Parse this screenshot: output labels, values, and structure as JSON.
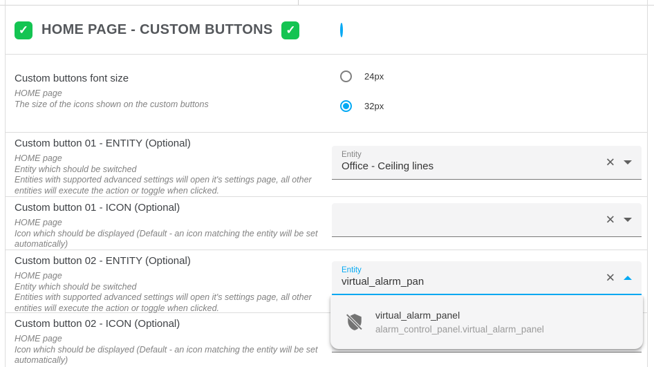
{
  "icons": {
    "check": "✓",
    "clear": "✕"
  },
  "colors": {
    "accent": "#03a9f4",
    "check_green": "#14c452"
  },
  "header": {
    "title": "HOME PAGE - CUSTOM BUTTONS"
  },
  "font_size_section": {
    "title": "Custom buttons font size",
    "subtitle": "HOME page",
    "description": "The size of the icons shown on the custom buttons",
    "options": [
      {
        "label": "24px",
        "selected": false
      },
      {
        "label": "32px",
        "selected": true
      }
    ]
  },
  "button01_entity": {
    "title": "Custom button 01 - ENTITY (Optional)",
    "subtitle": "HOME page",
    "line1": "Entity which should be switched",
    "line2": "Entities with supported advanced settings will open it's settings page, all other entities will execute the action or toggle when clicked.",
    "field_label": "Entity",
    "field_value": "Office - Ceiling lines"
  },
  "button01_icon": {
    "title": "Custom button 01 - ICON (Optional)",
    "subtitle": "HOME page",
    "line1": "Icon which should be displayed (Default - an icon matching the entity will be set automatically)",
    "field_value": ""
  },
  "button02_entity": {
    "title": "Custom button 02 - ENTITY (Optional)",
    "subtitle": "HOME page",
    "line1": "Entity which should be switched",
    "line2": "Entities with supported advanced settings will open it's settings page, all other entities will execute the action or toggle when clicked.",
    "field_label": "Entity",
    "field_value": "virtual_alarm_pan",
    "dropdown": {
      "items": [
        {
          "name": "virtual_alarm_panel",
          "entity_id": "alarm_control_panel.virtual_alarm_panel"
        }
      ]
    }
  },
  "button02_icon": {
    "title": "Custom button 02 - ICON (Optional)",
    "subtitle": "HOME page",
    "line1": "Icon which should be displayed (Default - an icon matching the entity will be set automatically)"
  }
}
